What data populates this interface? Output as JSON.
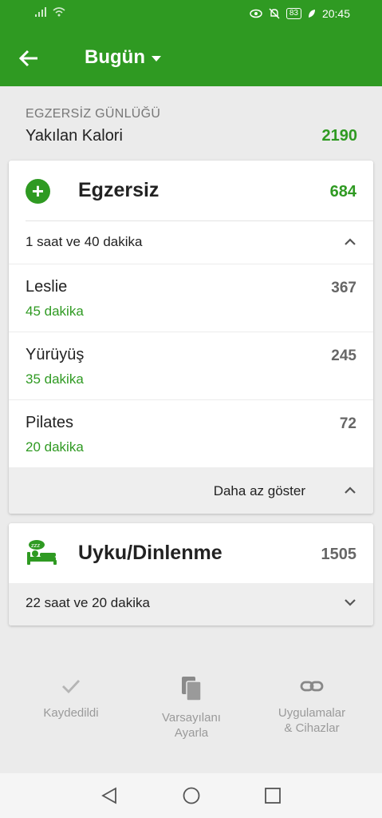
{
  "status_bar": {
    "time": "20:45",
    "battery": "83"
  },
  "toolbar": {
    "title": "Bugün"
  },
  "summary": {
    "section_label": "EGZERSİZ GÜNLÜĞÜ",
    "calories_label": "Yakılan Kalori",
    "calories_value": "2190"
  },
  "exercise": {
    "title": "Egzersiz",
    "total": "684",
    "duration": "1 saat ve 40 dakika",
    "items": [
      {
        "name": "Leslie",
        "duration": "45 dakika",
        "calories": "367"
      },
      {
        "name": "Yürüyüş",
        "duration": "35 dakika",
        "calories": "245"
      },
      {
        "name": "Pilates",
        "duration": "20 dakika",
        "calories": "72"
      }
    ],
    "show_less": "Daha az göster"
  },
  "sleep": {
    "title": "Uyku/Dinlenme",
    "total": "1505",
    "duration": "22 saat ve 20 dakika"
  },
  "actions": {
    "saved": "Kaydedildi",
    "default_line1": "Varsayılanı",
    "default_line2": "Ayarla",
    "apps_line1": "Uygulamalar",
    "apps_line2": "& Cihazlar"
  },
  "colors": {
    "accent": "#2f9a22",
    "background": "#ebebeb"
  },
  "icons": [
    "back-arrow-icon",
    "caret-down-icon",
    "plus-icon",
    "chevron-up-icon",
    "chevron-down-icon",
    "sleep-icon",
    "check-icon",
    "copy-icon",
    "link-icon"
  ]
}
